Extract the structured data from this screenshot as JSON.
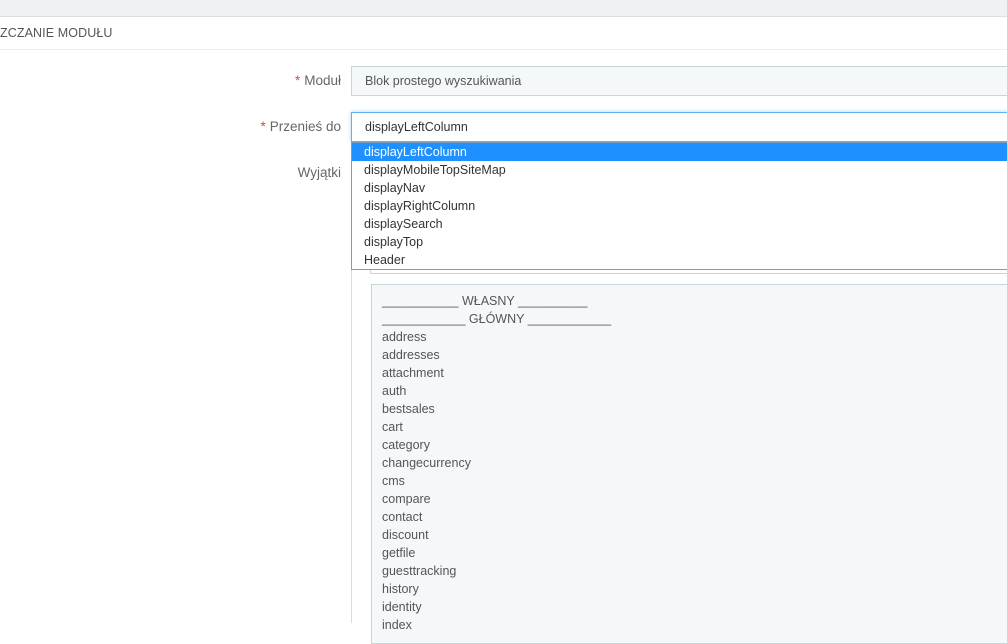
{
  "panel": {
    "heading": "ZCZANIE MODUŁU"
  },
  "form": {
    "module": {
      "required_mark": "*",
      "label": "Moduł",
      "value": "Blok prostego wyszukiwania"
    },
    "move_to": {
      "required_mark": "*",
      "label": "Przenieś do",
      "value": "displayLeftColumn",
      "options": [
        "displayLeftColumn",
        "displayMobileTopSiteMap",
        "displayNav",
        "displayRightColumn",
        "displaySearch",
        "displayTop",
        "Header"
      ],
      "selected_index": 0
    },
    "exceptions": {
      "label": "Wyjątki",
      "items": [
        "___________ WŁASNY __________",
        "____________ GŁÓWNY ____________",
        "address",
        "addresses",
        "attachment",
        "auth",
        "bestsales",
        "cart",
        "category",
        "changecurrency",
        "cms",
        "compare",
        "contact",
        "discount",
        "getfile",
        "guesttracking",
        "history",
        "identity",
        "index"
      ]
    }
  },
  "colors": {
    "required": "#e0463b",
    "selected_option_bg": "#1e90ff",
    "focus_border": "#66afe9"
  }
}
